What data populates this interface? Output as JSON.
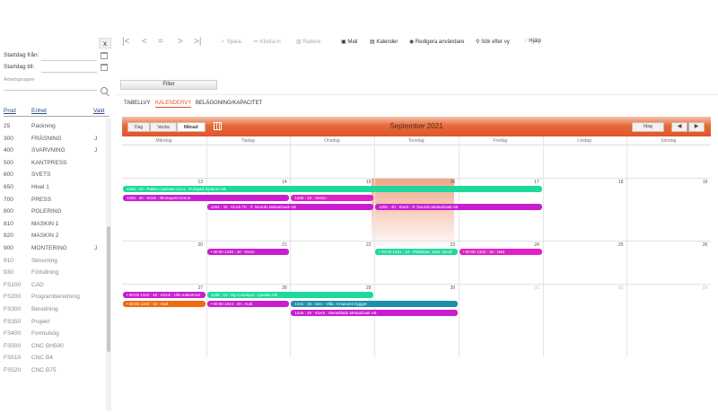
{
  "left": {
    "close": "x",
    "start_from": "Startdag från:",
    "start_to": "Startdag till:",
    "search_label": "Arbetsgrupper",
    "headers": [
      "Prod",
      "Enhet",
      "Vald"
    ],
    "rows": [
      {
        "code": "25",
        "name": "Packning",
        "sel": ""
      },
      {
        "code": "300",
        "name": "FRÄSNING",
        "sel": "J"
      },
      {
        "code": "400",
        "name": "SVARVNING",
        "sel": "J"
      },
      {
        "code": "500",
        "name": "KANTPRESS",
        "sel": ""
      },
      {
        "code": "600",
        "name": "SVETS",
        "sel": ""
      },
      {
        "code": "650",
        "name": "Hivel 1",
        "sel": ""
      },
      {
        "code": "700",
        "name": "PRESS",
        "sel": ""
      },
      {
        "code": "800",
        "name": "POLERING",
        "sel": ""
      },
      {
        "code": "810",
        "name": "MASKIN 1",
        "sel": ""
      },
      {
        "code": "820",
        "name": "MASKIN 2",
        "sel": ""
      },
      {
        "code": "900",
        "name": "MONTERING",
        "sel": "J"
      },
      {
        "code": "910",
        "name": "Skruvning",
        "sel": ""
      },
      {
        "code": "930",
        "name": "Förtullning",
        "sel": ""
      },
      {
        "code": "FS100",
        "name": "CAD",
        "sel": ""
      },
      {
        "code": "FS200",
        "name": "Programberedning",
        "sel": ""
      },
      {
        "code": "FS300",
        "name": "Beredning",
        "sel": ""
      },
      {
        "code": "FS350",
        "name": "Projekt",
        "sel": ""
      },
      {
        "code": "FS400",
        "name": "Formulsög",
        "sel": ""
      },
      {
        "code": "FS500",
        "name": "CNC BH500",
        "sel": ""
      },
      {
        "code": "FS510",
        "name": "CNC B4",
        "sel": ""
      },
      {
        "code": "FS520",
        "name": "CNC B75",
        "sel": ""
      }
    ]
  },
  "toolbar": {
    "nav": [
      "|<",
      "<",
      "=",
      ">",
      ">|"
    ],
    "save": "Spara",
    "paste": "Klistra in",
    "delete": "Radera",
    "mail": "Mail",
    "calendar": "Kalender",
    "edit_user": "Redigera användare",
    "search_view": "Sök efter vy",
    "help": "Hjälp"
  },
  "filter_label": "Filter",
  "tabs": [
    "TABELLVY",
    "KALENDERVY",
    "BELÄGGNING/KAPACITET"
  ],
  "calendar": {
    "views": [
      "Dag",
      "Vecka",
      "Månad"
    ],
    "month_title": "September 2021",
    "today_label": "Idag",
    "prev": "◀",
    "next": "▶",
    "weekdays": [
      "Måndag",
      "Tisdag",
      "Onsdag",
      "Torsdag",
      "Fredag",
      "Lördag",
      "Söndag"
    ],
    "weeks": [
      [
        "13",
        "14",
        "15",
        "16",
        "17",
        "18",
        "19"
      ],
      [
        "20",
        "21",
        "22",
        "23",
        "24",
        "25",
        "26"
      ],
      [
        "27",
        "28",
        "29",
        "30",
        "01",
        "02",
        "03"
      ]
    ],
    "events": [
      {
        "text": "1283 : 10 : Pakke Casevan 11A1 : Pumpad Synkron AB",
        "color": "#1ed99b",
        "row": 0,
        "slot": 0,
        "start": 0,
        "span": 5
      },
      {
        "text": "1293 : 40 : Klock : Blomquist Kenne",
        "color": "#c81ed0",
        "row": 0,
        "slot": 1,
        "start": 0,
        "span": 2
      },
      {
        "text": "1340 : 10 : Seiton",
        "color": "#e020c8",
        "row": 0,
        "slot": 1,
        "start": 2,
        "span": 1
      },
      {
        "text": "1292 : 40 : Klock TE : P. Noordo Metaalzaak AB",
        "color": "#c81ed0",
        "row": 0,
        "slot": 2,
        "start": 1,
        "span": 2
      },
      {
        "text": "1281 : 40 : Klock : P. Noordo Metaalzaak AB",
        "color": "#c81ed0",
        "row": 0,
        "slot": 2,
        "start": 3,
        "span": 2
      },
      {
        "text": "• 00:00 1330 : 40 : Klock",
        "color": "#c81ed0",
        "row": 1,
        "slot": 0,
        "start": 1,
        "span": 1
      },
      {
        "text": "• 00:00 1331 : 10 : Pelleblaa, 1631 Skrull",
        "color": "#1ed99b",
        "row": 1,
        "slot": 0,
        "start": 3,
        "span": 1
      },
      {
        "text": "• 00:00 1332 : 10 : Hatt",
        "color": "#e020c8",
        "row": 1,
        "slot": 0,
        "start": 4,
        "span": 1
      },
      {
        "text": "• 00:00 1342 : 40 : Klock : Lille Indentrost",
        "color": "#c81ed0",
        "row": 2,
        "slot": 0,
        "start": 0,
        "span": 1
      },
      {
        "text": "1345 : 10 : Ny Conveyor : Ajustae AB",
        "color": "#1ed99b",
        "row": 2,
        "slot": 0,
        "start": 1,
        "span": 2
      },
      {
        "text": "• 00:00 1343 : 10 : Hatt",
        "color": "#f06a10",
        "row": 2,
        "slot": 1,
        "start": 0,
        "span": 1
      },
      {
        "text": "• 00:00 1344 : 40 : Audi",
        "color": "#c81ed0",
        "row": 2,
        "slot": 1,
        "start": 1,
        "span": 1
      },
      {
        "text": "1341 : 30 : Sen - Villa : Knutsons bygget",
        "color": "#1e8fa8",
        "row": 2,
        "slot": 1,
        "start": 2,
        "span": 2
      },
      {
        "text": "1346 : 40 : Klock : Steneblads Metaalzaak AB",
        "color": "#c81ed0",
        "row": 2,
        "slot": 2,
        "start": 2,
        "span": 2
      }
    ]
  }
}
